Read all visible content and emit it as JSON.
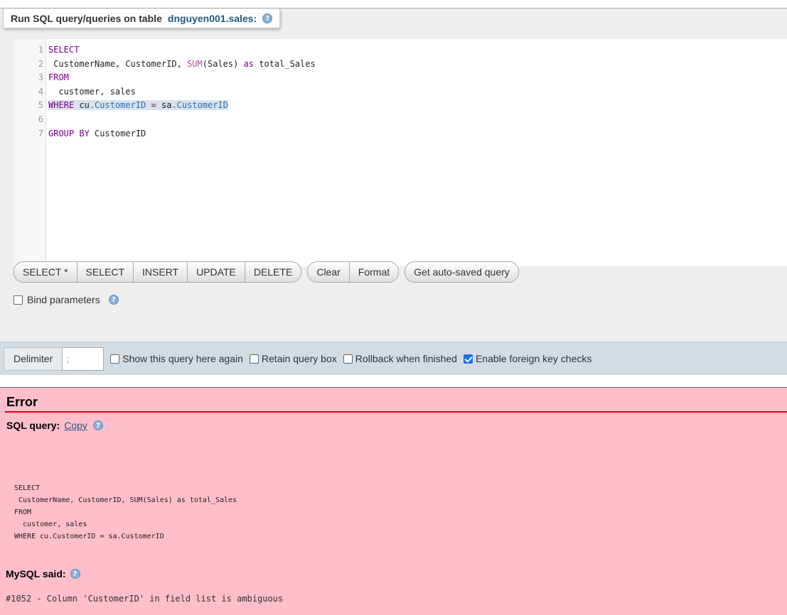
{
  "panel": {
    "legend_prefix": "Run SQL query/queries on table",
    "table_name": "dnguyen001.sales:",
    "help_glyph": "?"
  },
  "editor": {
    "line_numbers": [
      "1",
      "2",
      "3",
      "4",
      "5",
      "6",
      "7"
    ],
    "lines": [
      {
        "parts": [
          {
            "t": "SELECT",
            "c": "kw"
          }
        ]
      },
      {
        "parts": [
          {
            "t": " CustomerName, CustomerID, ",
            "c": ""
          },
          {
            "t": "SUM",
            "c": "fn"
          },
          {
            "t": "(Sales) ",
            "c": ""
          },
          {
            "t": "as",
            "c": "kw"
          },
          {
            "t": " total_Sales",
            "c": ""
          }
        ]
      },
      {
        "parts": [
          {
            "t": "FROM",
            "c": "kw"
          }
        ]
      },
      {
        "parts": [
          {
            "t": "  customer, sales",
            "c": ""
          }
        ]
      },
      {
        "parts": [
          {
            "t": "WHERE",
            "c": "kw hl"
          },
          {
            "t": " cu",
            "c": "hl"
          },
          {
            "t": ".CustomerID",
            "c": "prop hl"
          },
          {
            "t": " ",
            "c": "hl"
          },
          {
            "t": "=",
            "c": "op hl"
          },
          {
            "t": " sa",
            "c": "hl"
          },
          {
            "t": ".CustomerID",
            "c": "prop hl"
          }
        ]
      },
      {
        "parts": []
      },
      {
        "parts": [
          {
            "t": "GROUP BY",
            "c": "kw"
          },
          {
            "t": " CustomerID",
            "c": ""
          }
        ]
      }
    ]
  },
  "buttons": {
    "select_star": "SELECT *",
    "select": "SELECT",
    "insert": "INSERT",
    "update": "UPDATE",
    "delete": "DELETE",
    "clear": "Clear",
    "format": "Format",
    "autosaved": "Get auto-saved query"
  },
  "bind_params": {
    "label": "Bind parameters",
    "checked": false
  },
  "options": {
    "delimiter_label": "Delimiter",
    "delimiter_value": ";",
    "show_again": "Show this query here again",
    "retain_box": "Retain query box",
    "rollback": "Rollback when finished",
    "fk_checks": "Enable foreign key checks",
    "fk_checks_checked": true
  },
  "error": {
    "title": "Error",
    "sql_query_label": "SQL query:",
    "copy_label": "Copy",
    "query_text": "SELECT\n CustomerName, CustomerID, SUM(Sales) as total_Sales\nFROM\n  customer, sales\nWHERE cu.CustomerID = sa.CustomerID",
    "mysql_said_label": "MySQL said:",
    "message": "#1052 - Column 'CustomerID' in field list is ambiguous"
  },
  "colors": {
    "error_bg": "#ffbecb",
    "error_rule": "#e00000",
    "link": "#235a81",
    "options_bar": "#d3dce3",
    "panel_bg": "#eeeeee"
  }
}
